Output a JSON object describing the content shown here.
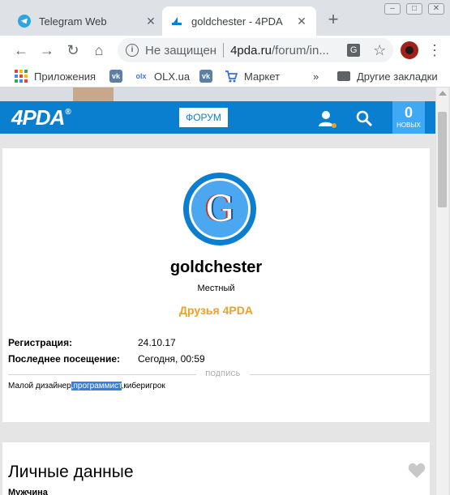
{
  "browser": {
    "tabs": [
      {
        "title": "Telegram Web",
        "favicon": "telegram-icon",
        "active": false
      },
      {
        "title": "goldchester - 4PDA",
        "favicon": "4pda-icon",
        "active": true
      }
    ],
    "new_tab": "+",
    "omnibox": {
      "security_text": "Не защищен",
      "url_host": "4pda.ru",
      "url_path": "/forum/in..."
    },
    "bookmarks": [
      {
        "label": "Приложения",
        "icon": "apps-grid-icon"
      },
      {
        "label": "",
        "icon": "vk-icon"
      },
      {
        "label": "OLX.ua",
        "icon": "olx-icon"
      },
      {
        "label": "",
        "icon": "vk-icon"
      },
      {
        "label": "Маркет",
        "icon": "cart-icon"
      },
      {
        "label": "»",
        "icon": "overflow-chevron-icon"
      },
      {
        "label": "Другие закладки",
        "icon": "folder-icon"
      }
    ]
  },
  "site": {
    "logo": "4PDA",
    "logo_reg": "®",
    "forum_button": "ФОРУМ",
    "notifications": {
      "count": "0",
      "label": "НОВЫХ"
    },
    "colors": {
      "brand": "#0b7fcf",
      "accent": "#f0a024",
      "notif": "#3fa9f5"
    }
  },
  "profile": {
    "avatar_letter": "G",
    "username": "goldchester",
    "rank": "Местный",
    "group": "Друзья 4PDA",
    "registration_label": "Регистрация:",
    "registration_value": "24.10.17",
    "last_visit_label": "Последнее посещение:",
    "last_visit_value": "Сегодня, 00:59",
    "signature_label": "ПОДПИСЬ",
    "signature": {
      "before": "Малой дизайнер",
      "highlight": ",программист",
      "after": ",киберигрок"
    }
  },
  "personal": {
    "title": "Личные данные",
    "gender_partial": "Мужчина"
  }
}
